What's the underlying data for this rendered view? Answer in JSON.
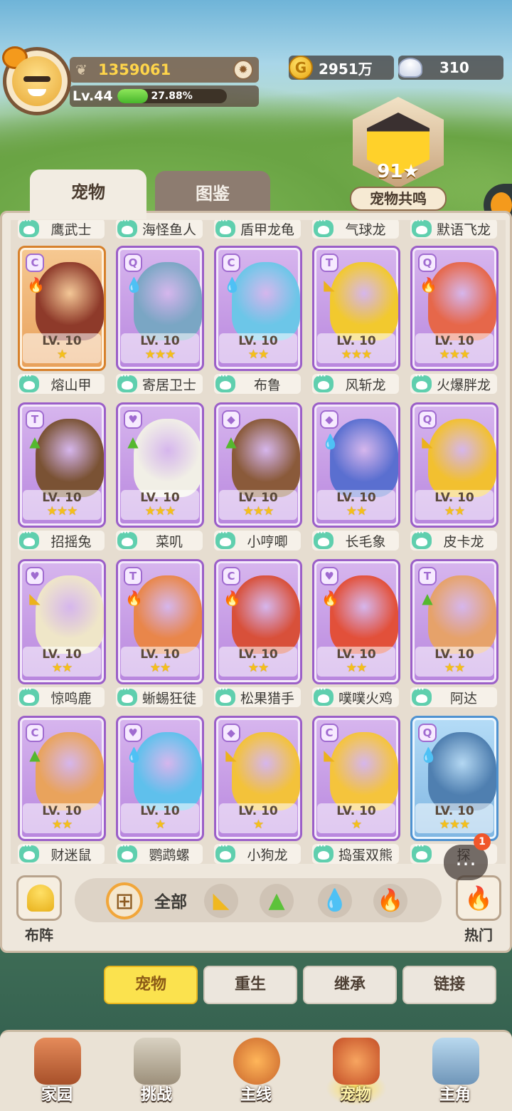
{
  "player": {
    "score": "1359061",
    "level": "Lv.44",
    "xp_percent": "27.88%",
    "xp_fraction": 0.2788
  },
  "currency": {
    "gold": "2951万",
    "shells": "310"
  },
  "resonance": {
    "level": "91★",
    "label": "宠物共鸣"
  },
  "tabs": [
    "宠物",
    "图鉴"
  ],
  "top_row_names": [
    "鹰武士",
    "海怪鱼人",
    "盾甲龙龟",
    "气球龙",
    "默语飞龙"
  ],
  "rows": [
    {
      "cards": [
        {
          "level": "LV. 10",
          "stars": "★",
          "badge": "C",
          "element": "fire",
          "tone": "orange",
          "color": "#8e3a2a"
        },
        {
          "level": "LV. 10",
          "stars": "★★★",
          "badge": "Q",
          "element": "water",
          "tone": "purple",
          "color": "#7aa6c4"
        },
        {
          "level": "LV. 10",
          "stars": "★★",
          "badge": "C",
          "element": "water",
          "tone": "purple",
          "color": "#6cc6e8"
        },
        {
          "level": "LV. 10",
          "stars": "★★★",
          "badge": "T",
          "element": "earth",
          "tone": "purple",
          "color": "#f2c92e"
        },
        {
          "level": "LV. 10",
          "stars": "★★★",
          "badge": "Q",
          "element": "fire",
          "tone": "purple",
          "color": "#e6674a"
        }
      ],
      "names": [
        "熔山甲",
        "寄居卫士",
        "布鲁",
        "风斩龙",
        "火爆胖龙"
      ]
    },
    {
      "cards": [
        {
          "level": "LV. 10",
          "stars": "★★★",
          "badge": "T",
          "element": "grass",
          "tone": "purple",
          "color": "#7a5234"
        },
        {
          "level": "LV. 10",
          "stars": "★★★",
          "badge": "♥",
          "element": "grass",
          "tone": "purple",
          "color": "#f1efe6"
        },
        {
          "level": "LV. 10",
          "stars": "★★★",
          "badge": "◆",
          "element": "grass",
          "tone": "purple",
          "color": "#8a5a3a"
        },
        {
          "level": "LV. 10",
          "stars": "★★",
          "badge": "◆",
          "element": "water",
          "tone": "purple",
          "color": "#5a6fd0"
        },
        {
          "level": "LV. 10",
          "stars": "★★",
          "badge": "Q",
          "element": "earth",
          "tone": "purple",
          "color": "#f2c030"
        }
      ],
      "names": [
        "招摇兔",
        "菜叽",
        "小哼唧",
        "长毛象",
        "皮卡龙"
      ]
    },
    {
      "cards": [
        {
          "level": "LV. 10",
          "stars": "★★",
          "badge": "♥",
          "element": "earth",
          "tone": "purple",
          "color": "#efe6c8"
        },
        {
          "level": "LV. 10",
          "stars": "★★",
          "badge": "T",
          "element": "fire",
          "tone": "purple",
          "color": "#e9864a"
        },
        {
          "level": "LV. 10",
          "stars": "★★",
          "badge": "C",
          "element": "fire",
          "tone": "purple",
          "color": "#d8503a"
        },
        {
          "level": "LV. 10",
          "stars": "★★",
          "badge": "♥",
          "element": "fire",
          "tone": "purple",
          "color": "#e2503a"
        },
        {
          "level": "LV. 10",
          "stars": "★★",
          "badge": "T",
          "element": "grass",
          "tone": "purple",
          "color": "#e6a26a"
        }
      ],
      "names": [
        "惊鸣鹿",
        "蜥蜴狂徒",
        "松果猎手",
        "噗噗火鸡",
        "阿达"
      ]
    },
    {
      "cards": [
        {
          "level": "LV. 10",
          "stars": "★★",
          "badge": "C",
          "element": "grass",
          "tone": "purple",
          "color": "#e9a35c"
        },
        {
          "level": "LV. 10",
          "stars": "★",
          "badge": "♥",
          "element": "water",
          "tone": "purple",
          "color": "#5fc0ec"
        },
        {
          "level": "LV. 10",
          "stars": "★",
          "badge": "◆",
          "element": "earth",
          "tone": "purple",
          "color": "#f3c23a"
        },
        {
          "level": "LV. 10",
          "stars": "★",
          "badge": "C",
          "element": "earth",
          "tone": "purple",
          "color": "#f5c43c"
        },
        {
          "level": "LV. 10",
          "stars": "★★★",
          "badge": "Q",
          "element": "water",
          "tone": "blue",
          "color": "#4f7fb0"
        }
      ],
      "names": [
        "财迷鼠",
        "鹦鹉螺",
        "小狗龙",
        "捣蛋双熊",
        "探"
      ]
    }
  ],
  "filters": {
    "formation": "布阵",
    "all": "全部",
    "hot": "热门",
    "chat_count": "1"
  },
  "actions": [
    "宠物",
    "重生",
    "继承",
    "链接"
  ],
  "nav": [
    "家园",
    "挑战",
    "主线",
    "宠物",
    "主角"
  ],
  "colors": {
    "accent_yellow": "#fbe24e",
    "card_purple": "#b886de",
    "card_orange": "#e8a05a",
    "card_blue": "#7fb6e2",
    "paw_green": "#5fcfae"
  }
}
